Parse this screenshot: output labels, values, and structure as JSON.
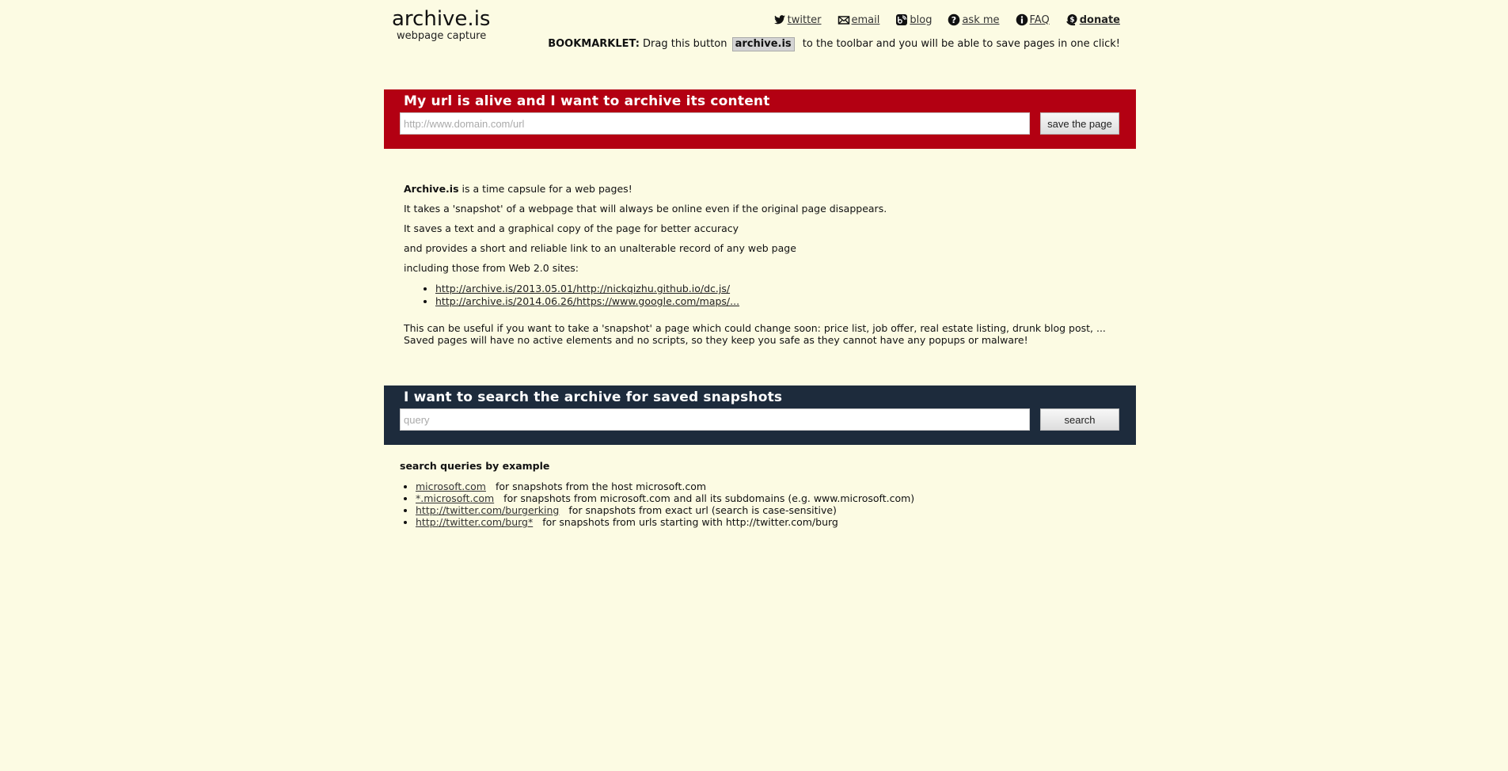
{
  "header": {
    "logo_title": "archive.is",
    "logo_subtitle": "webpage capture",
    "nav": [
      {
        "label": "twitter",
        "icon": "twitter-icon"
      },
      {
        "label": "email",
        "icon": "email-icon"
      },
      {
        "label": "blog",
        "icon": "blog-icon"
      },
      {
        "label": "ask me",
        "icon": "question-icon"
      },
      {
        "label": "FAQ",
        "icon": "info-icon"
      },
      {
        "label": "donate",
        "icon": "donate-icon"
      }
    ],
    "bookmarklet": {
      "label": "BOOKMARKLET:",
      "prefix": "Drag this button",
      "button": "archive.is",
      "suffix": "to the toolbar and you will be able to save pages in one click!"
    }
  },
  "save_panel": {
    "title": "My url is alive and I want to archive its content",
    "input_placeholder": "http://www.domain.com/url",
    "input_value": "",
    "button": "save the page",
    "color": "#b30012"
  },
  "description": {
    "brand": "Archive.is",
    "line1_rest": " is a time capsule for a web pages!",
    "line2": "It takes a 'snapshot' of a webpage that will always be online even if the original page disappears.",
    "line3": "It saves a text and a graphical copy of the page for better accuracy",
    "line4": "and provides a short and reliable link to an unalterable record of any web page",
    "line5": "including those from Web 2.0 sites:",
    "links": [
      "http://archive.is/2013.05.01/http://nickqizhu.github.io/dc.js/",
      "http://archive.is/2014.06.26/https://www.google.com/maps/..."
    ],
    "note1": "This can be useful if you want to take a 'snapshot' a page which could change soon: price list, job offer, real estate listing, drunk blog post, ...",
    "note2": "Saved pages will have no active elements and no scripts, so they keep you safe as they cannot have any popups or malware!"
  },
  "search_panel": {
    "title": "I want to search the archive for saved snapshots",
    "input_placeholder": "query",
    "input_value": "",
    "button": "search",
    "color": "#1d2b3c"
  },
  "examples": {
    "heading": "search queries by example",
    "items": [
      {
        "query": "microsoft.com",
        "desc": "for snapshots from the host microsoft.com"
      },
      {
        "query": "*.microsoft.com",
        "desc": "for snapshots from microsoft.com and all its subdomains (e.g. www.microsoft.com)"
      },
      {
        "query": "http://twitter.com/burgerking",
        "desc": "for snapshots from exact url (search is case-sensitive)"
      },
      {
        "query": "http://twitter.com/burg*",
        "desc": "for snapshots from urls starting with http://twitter.com/burg"
      }
    ]
  }
}
